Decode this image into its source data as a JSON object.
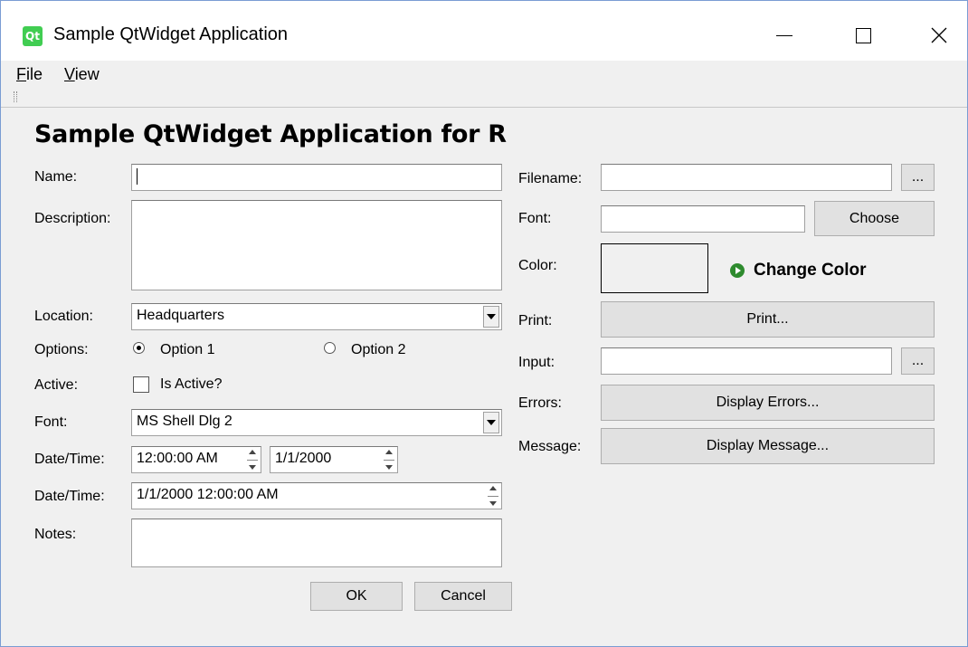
{
  "window": {
    "title": "Sample QtWidget Application",
    "icon_label": "Qt"
  },
  "menu": {
    "items": [
      {
        "label": "File",
        "mnemonic": "F",
        "rest": "ile"
      },
      {
        "label": "View",
        "mnemonic": "V",
        "rest": "iew"
      }
    ]
  },
  "main": {
    "heading": "Sample QtWidget Application for R"
  },
  "left_form": {
    "name_label": "Name:",
    "name_value": "",
    "description_label": "Description:",
    "description_value": "",
    "location_label": "Location:",
    "location_value": "Headquarters",
    "options_label": "Options:",
    "option1_label": "Option 1",
    "option1_checked": true,
    "option2_label": "Option 2",
    "option2_checked": false,
    "active_label": "Active:",
    "is_active_label": "Is Active?",
    "is_active_checked": false,
    "font_label": "Font:",
    "font_value": "MS Shell Dlg 2",
    "datetime1_label": "Date/Time:",
    "time_value": "12:00:00 AM",
    "date_value": "1/1/2000",
    "datetime2_label": "Date/Time:",
    "datetime_value": "1/1/2000 12:00:00 AM",
    "notes_label": "Notes:",
    "notes_value": "",
    "ok_label": "OK",
    "cancel_label": "Cancel"
  },
  "right_form": {
    "filename_label": "Filename:",
    "filename_value": "",
    "browse_label": "...",
    "font_label": "Font:",
    "font_value": "",
    "choose_label": "Choose",
    "color_label": "Color:",
    "color_swatch": "#f0f0f0",
    "change_color_label": "Change Color",
    "print_label": "Print:",
    "print_button": "Print...",
    "input_label": "Input:",
    "input_value": "",
    "input_browse_label": "...",
    "errors_label": "Errors:",
    "errors_button": "Display Errors...",
    "message_label": "Message:",
    "message_button": "Display Message..."
  },
  "colors": {
    "window_border": "#7a9cd3",
    "qt_green": "#41cd52",
    "arrow_green": "#2e8b2e"
  }
}
